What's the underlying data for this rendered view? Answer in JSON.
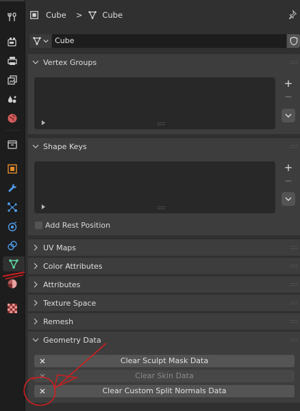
{
  "header": {
    "object_name": "Cube",
    "mesh_name": "Cube",
    "separator": ">"
  },
  "datablock": {
    "name": "Cube"
  },
  "panels": {
    "vertex_groups": {
      "title": "Vertex Groups",
      "expanded": true
    },
    "shape_keys": {
      "title": "Shape Keys",
      "expanded": true,
      "add_rest_position": "Add Rest Position",
      "add_rest_position_checked": false
    },
    "uv_maps": {
      "title": "UV Maps",
      "expanded": false
    },
    "color_attributes": {
      "title": "Color Attributes",
      "expanded": false
    },
    "attributes": {
      "title": "Attributes",
      "expanded": false
    },
    "texture_space": {
      "title": "Texture Space",
      "expanded": false
    },
    "remesh": {
      "title": "Remesh",
      "expanded": false
    },
    "geometry_data": {
      "title": "Geometry Data",
      "expanded": true,
      "buttons": [
        {
          "label": "Clear Sculpt Mask Data",
          "enabled": true
        },
        {
          "label": "Clear Skin Data",
          "enabled": false
        },
        {
          "label": "Clear Custom Split Normals Data",
          "enabled": true
        }
      ]
    }
  },
  "list_controls": {
    "add": "+",
    "remove": "−"
  },
  "tabs": [
    "tool-icon",
    "render-icon",
    "output-icon",
    "view-layer-icon",
    "scene-icon",
    "world-icon",
    "collection-icon",
    "object-icon",
    "modifier-icon",
    "particles-icon",
    "physics-icon",
    "constraints-icon",
    "object-data-icon",
    "material-icon",
    "texture-icon"
  ],
  "active_tab": "object-data-icon",
  "colors": {
    "active_tab_icon": "#5fd5a0",
    "annotation": "#d21e1e",
    "accent_orange": "#e38d2e",
    "world_red": "#d35e5e",
    "modifier_blue": "#4f9be8"
  }
}
